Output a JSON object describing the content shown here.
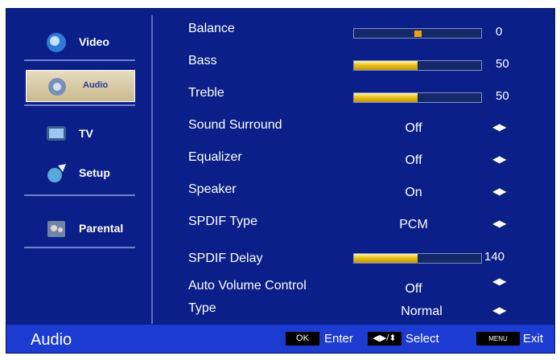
{
  "sidebar": {
    "items": [
      {
        "label": "Video",
        "icon": "video-icon",
        "selected": false
      },
      {
        "label": "Audio",
        "icon": "audio-icon",
        "selected": true
      },
      {
        "label": "TV",
        "icon": "tv-icon",
        "selected": false
      },
      {
        "label": "Setup",
        "icon": "setup-icon",
        "selected": false
      },
      {
        "label": "Parental",
        "icon": "parental-icon",
        "selected": false
      }
    ]
  },
  "menu": {
    "rows": [
      {
        "label": "Balance",
        "value": "0",
        "level": 0
      },
      {
        "label": "Bass",
        "value": "50",
        "level": 50
      },
      {
        "label": "Treble",
        "value": "50",
        "level": 50
      },
      {
        "label": "Sound Surround",
        "value": "Off"
      },
      {
        "label": "Equalizer",
        "value": "Off"
      },
      {
        "label": "Speaker",
        "value": "On"
      },
      {
        "label": "SPDIF Type",
        "value": "PCM"
      },
      {
        "label": "SPDIF Delay",
        "value": "140"
      },
      {
        "label": "Auto Volume Control",
        "value": "Off"
      },
      {
        "label": "Type",
        "value": "Normal"
      }
    ]
  },
  "footer": {
    "title": "Audio",
    "ok_key": "OK",
    "enter_label": "Enter",
    "select_label": "Select",
    "menu_key": "MENU",
    "exit_label": "Exit"
  },
  "colors": {
    "background": "#0a1f87",
    "footer": "#1b3bd1",
    "bar_fill": "#e9c21c",
    "knob": "#e9a412"
  }
}
